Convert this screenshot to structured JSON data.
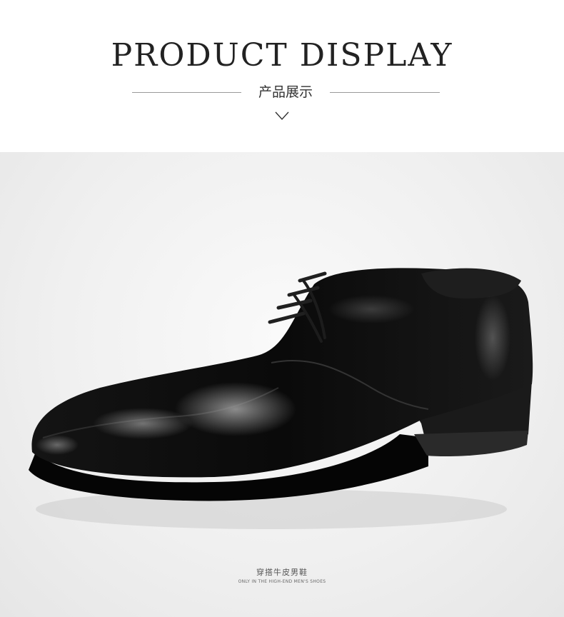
{
  "header": {
    "title": "PRODUCT DISPLAY",
    "subtitle": "产品展示",
    "scroll_icon": "chevron-down-icon"
  },
  "photo": {
    "subject": "black-leather-derby-shoe",
    "caption_cn": "穿搭牛皮男鞋",
    "caption_en": "ONLY IN THE HIGH-END MEN'S SHOES"
  },
  "colors": {
    "background": "#ffffff",
    "photo_backdrop": "#efefef",
    "title_text": "#222222",
    "rule": "#9a9a9a",
    "shoe": "#0c0c0c"
  }
}
